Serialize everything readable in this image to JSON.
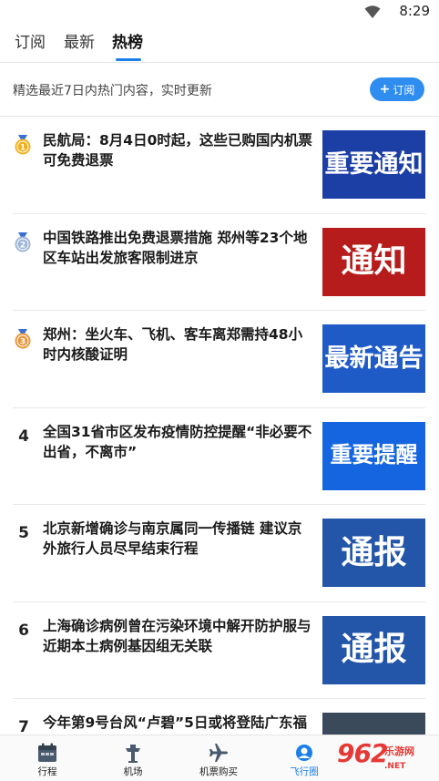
{
  "status": {
    "time": "8:29",
    "wifi_icon": "wifi-icon"
  },
  "tabs": [
    {
      "label": "订阅"
    },
    {
      "label": "最新"
    },
    {
      "label": "热榜"
    }
  ],
  "info": {
    "text": "精选最近7日内热门内容，实时更新",
    "subscribe_plus": "+",
    "subscribe_label": "订阅"
  },
  "news": [
    {
      "rank": "1",
      "title": "民航局：8月4日0时起，这些已购国内机票可免费退票",
      "thumb_text": "重要\n通知",
      "thumb_color": "#1c3fa5"
    },
    {
      "rank": "2",
      "title": "中国铁路推出免费退票措施 郑州等23个地区车站出发旅客限制进京",
      "thumb_text": "通知",
      "thumb_color": "#b71c1c"
    },
    {
      "rank": "3",
      "title": "郑州：坐火车、飞机、客车离郑需持48小时内核酸证明",
      "thumb_text": "最新\n通告",
      "thumb_color": "#1e5bc6"
    },
    {
      "rank": "4",
      "title": "全国31省市区发布疫情防控提醒“非必要不出省，不离市”",
      "thumb_text": "重要提醒",
      "thumb_color": "#1565e0"
    },
    {
      "rank": "5",
      "title": "北京新增确诊与南京属同一传播链 建议京外旅行人员尽早结束行程",
      "thumb_text": "通报",
      "thumb_color": "#2355a8"
    },
    {
      "rank": "6",
      "title": "上海确诊病例曾在污染环境中解开防护服与近期本土病例基因组无关联",
      "thumb_text": "通报",
      "thumb_color": "#2355a8"
    },
    {
      "rank": "7",
      "title": "今年第9号台风“卢碧”5日或将登陆广东福",
      "thumb_text": "",
      "thumb_color": "#3a4a5a"
    }
  ],
  "bottom_nav": [
    {
      "label": "行程",
      "icon": "calendar-icon"
    },
    {
      "label": "机场",
      "icon": "tower-icon"
    },
    {
      "label": "机票购买",
      "icon": "airplane-icon"
    },
    {
      "label": "飞行圈",
      "icon": "circle-icon"
    }
  ],
  "watermark": {
    "big": "962",
    "small_top": "乐游网",
    "small_bottom": ".NET"
  },
  "colors": {
    "accent": "#1a7fe8",
    "button": "#2f8df0"
  }
}
